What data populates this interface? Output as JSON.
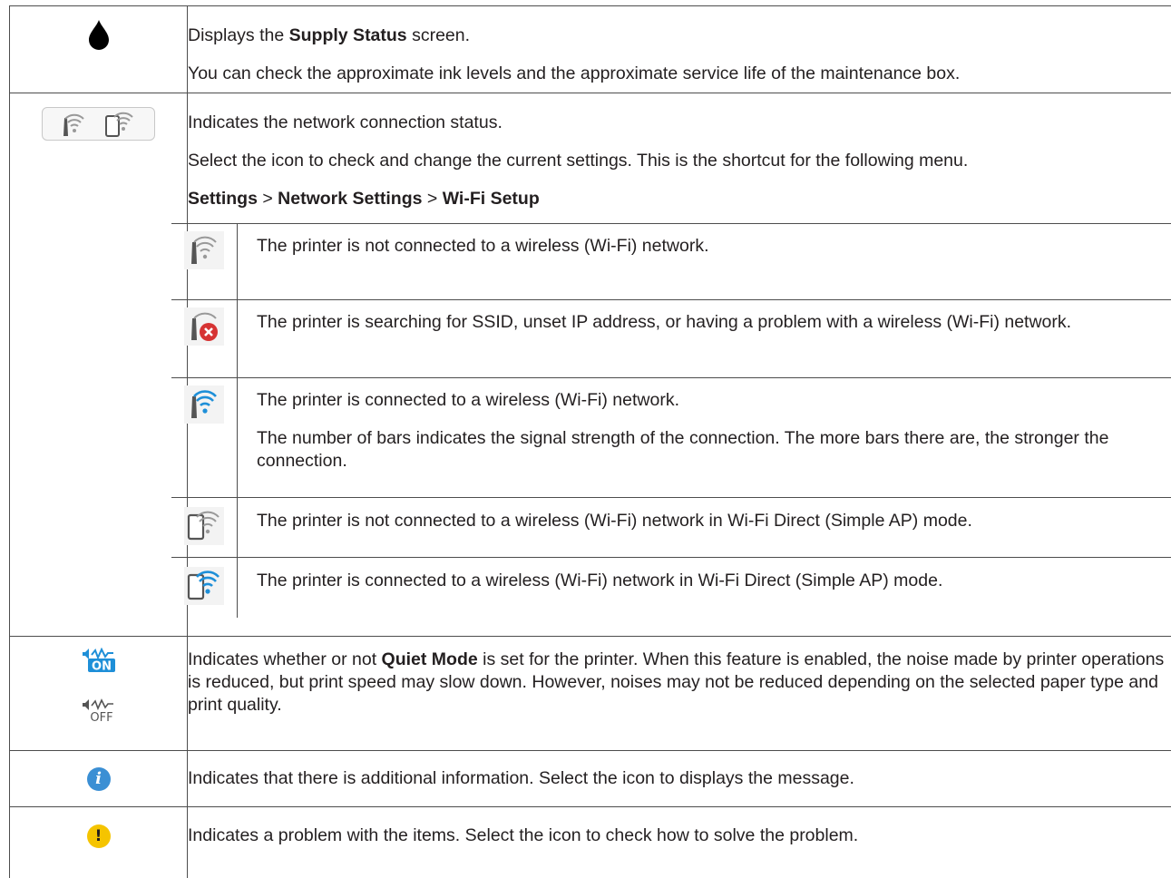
{
  "rows": {
    "supply": {
      "icon": "ink-drop-icon",
      "line1_pre": "Displays the ",
      "line1_bold": "Supply Status",
      "line1_post": " screen.",
      "line2": "You can check the approximate ink levels and the approximate service life of the maintenance box."
    },
    "network": {
      "icon": "network-status-icon",
      "line1": "Indicates the network connection status.",
      "line2": "Select the icon to check and change the current settings. This is the shortcut for the following menu.",
      "path": {
        "a": "Settings",
        "sep1": " > ",
        "b": "Network Settings",
        "sep2": " > ",
        "c": "Wi-Fi Setup"
      },
      "states": [
        {
          "icon": "wifi-disconnected-icon",
          "text": "The printer is not connected to a wireless (Wi-Fi) network."
        },
        {
          "icon": "wifi-error-icon",
          "text": "The printer is searching for SSID, unset IP address, or having a problem with a wireless (Wi-Fi) network."
        },
        {
          "icon": "wifi-connected-icon",
          "text": "The printer is connected to a wireless (Wi-Fi) network.",
          "text2": "The number of bars indicates the signal strength of the connection. The more bars there are, the stronger the connection."
        },
        {
          "icon": "wifi-direct-disconnected-icon",
          "text": "The printer is not connected to a wireless (Wi-Fi) network in Wi-Fi Direct (Simple AP) mode."
        },
        {
          "icon": "wifi-direct-connected-icon",
          "text": "The printer is connected to a wireless (Wi-Fi) network in Wi-Fi Direct (Simple AP) mode."
        }
      ]
    },
    "quiet": {
      "icon_on": "quiet-mode-on-icon",
      "icon_off": "quiet-mode-off-icon",
      "on_label": "ON",
      "off_label": "OFF",
      "text_pre": "Indicates whether or not ",
      "text_bold": "Quiet Mode",
      "text_post": " is set for the printer. When this feature is enabled, the noise made by printer operations is reduced, but print speed may slow down. However, noises may not be reduced depending on the selected paper type and print quality."
    },
    "info": {
      "icon": "info-icon",
      "glyph": "i",
      "text": "Indicates that there is additional information. Select the icon to displays the message."
    },
    "warning": {
      "icon": "warning-icon",
      "glyph": "!",
      "text": "Indicates a problem with the items. Select the icon to check how to solve the problem."
    }
  },
  "colors": {
    "wifi_blue": "#1e8fd8",
    "icon_gray": "#555555",
    "error_red": "#d63333",
    "info_blue": "#3b8fd4",
    "warning_yellow": "#f5c400",
    "rule": "#4d4d4d"
  }
}
